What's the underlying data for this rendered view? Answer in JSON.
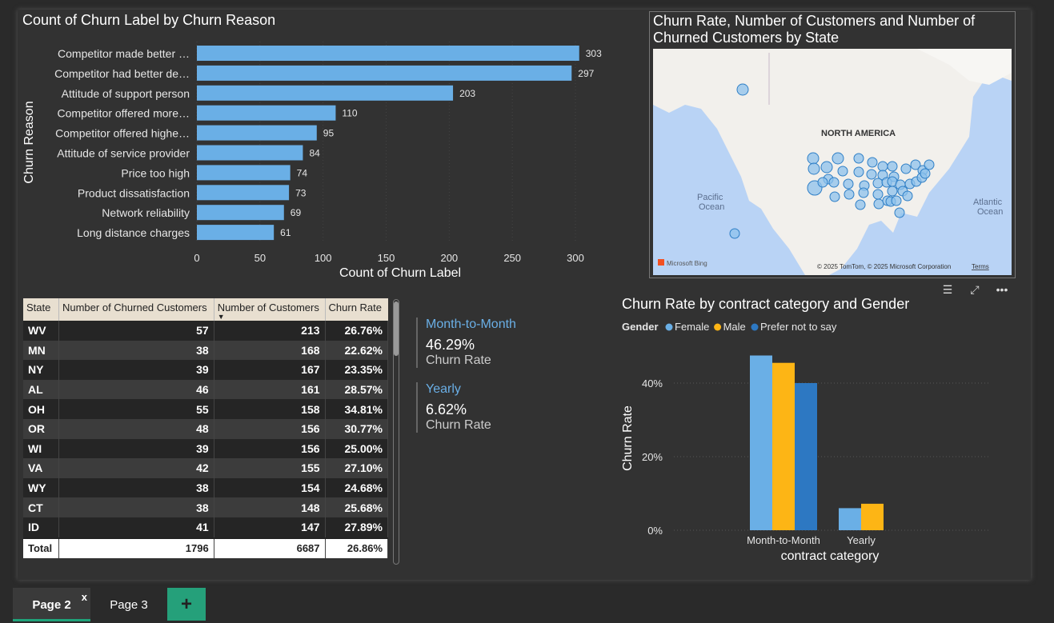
{
  "bar_visual": {
    "title": "Count of Churn Label by Churn Reason"
  },
  "map_visual": {
    "title": "Churn Rate, Number of Customers and Number of Churned Customers by State",
    "labels": {
      "continent": "NORTH AMERICA",
      "pacific": "Pacific\nOcean",
      "atlantic": "Atlantic\nOcean"
    },
    "attribution": "© 2025 TomTom, © 2025 Microsoft Corporation",
    "terms": "Terms",
    "bing": "Microsoft Bing",
    "toolbar_icons": [
      "filter-icon",
      "focus-mode-icon",
      "more-options-icon"
    ]
  },
  "table": {
    "headers": [
      "State",
      "Number of Churned Customers",
      "Number of Customers",
      "Churn Rate"
    ],
    "sorted_column": "Number of Customers",
    "rows": [
      [
        "WV",
        "57",
        "213",
        "26.76%"
      ],
      [
        "MN",
        "38",
        "168",
        "22.62%"
      ],
      [
        "NY",
        "39",
        "167",
        "23.35%"
      ],
      [
        "AL",
        "46",
        "161",
        "28.57%"
      ],
      [
        "OH",
        "55",
        "158",
        "34.81%"
      ],
      [
        "OR",
        "48",
        "156",
        "30.77%"
      ],
      [
        "WI",
        "39",
        "156",
        "25.00%"
      ],
      [
        "VA",
        "42",
        "155",
        "27.10%"
      ],
      [
        "WY",
        "38",
        "154",
        "24.68%"
      ],
      [
        "CT",
        "38",
        "148",
        "25.68%"
      ],
      [
        "ID",
        "41",
        "147",
        "27.89%"
      ]
    ],
    "total": [
      "Total",
      "1796",
      "6687",
      "26.86%"
    ]
  },
  "cards": [
    {
      "category": "Month-to-Month",
      "value": "46.29%",
      "label": "Churn Rate"
    },
    {
      "category": "Yearly",
      "value": "6.62%",
      "label": "Churn Rate"
    }
  ],
  "tabs": {
    "pages": [
      "Page 2",
      "Page 3"
    ],
    "active": "Page 2",
    "close": "x",
    "add": "+"
  },
  "colors": {
    "bar": "#6aafe6",
    "female": "#6aafe6",
    "male": "#fdb515",
    "prefer_not": "#2d78c2",
    "accent": "#25a07a"
  },
  "chart_data": [
    {
      "type": "bar",
      "orientation": "horizontal",
      "title": "Count of Churn Label by Churn Reason",
      "xlabel": "Count of Churn Label",
      "ylabel": "Churn Reason",
      "categories": [
        "Competitor made better …",
        "Competitor had better de…",
        "Attitude of support person",
        "Competitor offered more…",
        "Competitor offered highe…",
        "Attitude of service provider",
        "Price too high",
        "Product dissatisfaction",
        "Network reliability",
        "Long distance charges"
      ],
      "values": [
        303,
        297,
        203,
        110,
        95,
        84,
        74,
        73,
        69,
        61
      ],
      "xlim": [
        0,
        300
      ],
      "xticks": [
        0,
        50,
        100,
        150,
        200,
        250,
        300
      ],
      "grid": true
    },
    {
      "type": "bar",
      "title": "Churn Rate by contract category and Gender",
      "xlabel": "contract category",
      "ylabel": "Churn Rate",
      "legend_title": "Gender",
      "legend_placement": "top-left",
      "categories": [
        "Month-to-Month",
        "Yearly"
      ],
      "series": [
        {
          "name": "Female",
          "values": [
            47.5,
            6.0
          ]
        },
        {
          "name": "Male",
          "values": [
            45.5,
            7.2
          ]
        },
        {
          "name": "Prefer not to say",
          "values": [
            40.0,
            null
          ]
        }
      ],
      "yticks": [
        "0%",
        "20%",
        "40%"
      ],
      "ylim": [
        0,
        50
      ],
      "grid": true
    }
  ]
}
